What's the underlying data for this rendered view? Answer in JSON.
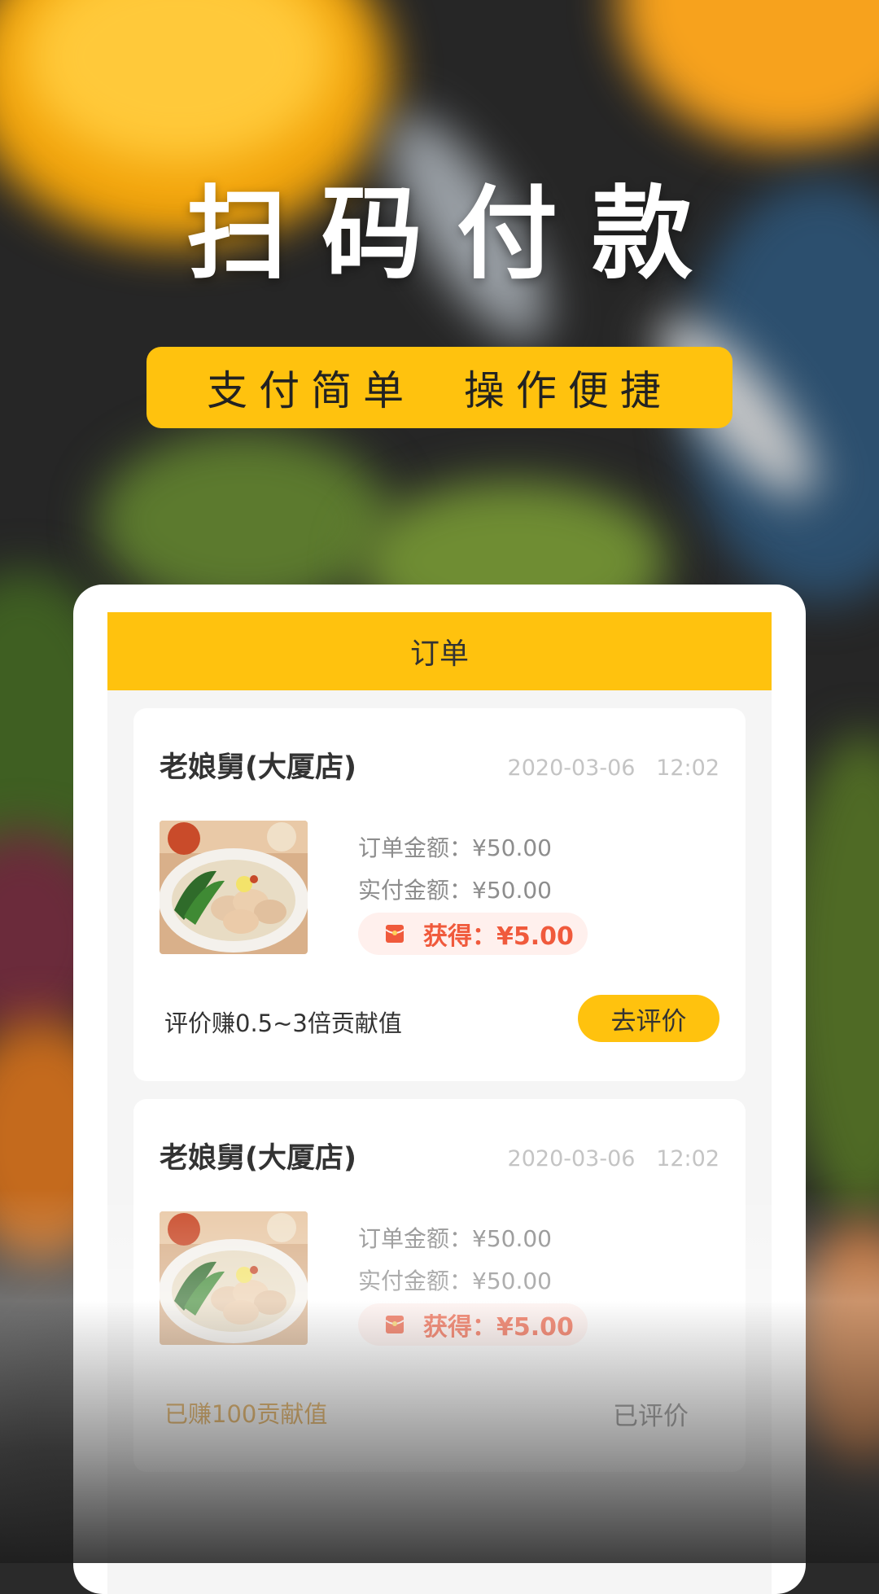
{
  "headline": "扫码付款",
  "tagline": "支付简单  操作便捷",
  "screen": {
    "title": "订单",
    "orders": [
      {
        "shop": "老娘舅(大厦店)",
        "time": "2020-03-06   12:02",
        "order_amount": "订单金额：¥50.00",
        "paid_amount": "实付金额：¥50.00",
        "earned": "获得：¥5.00",
        "hint": "评价赚0.5~3倍贡献值",
        "review_button": "去评价"
      },
      {
        "shop": "老娘舅(大厦店)",
        "time": "2020-03-06   12:02",
        "order_amount": "订单金额：¥50.00",
        "paid_amount": "实付金额：¥50.00",
        "earned": "获得：¥5.00",
        "earned_note": "已赚100贡献值",
        "review_status": "已评价"
      }
    ]
  },
  "colors": {
    "accent": "#ffc20e",
    "earn_text": "#f05a3c",
    "earned_note": "#e0a548"
  },
  "icons": [
    "red-envelope-icon",
    "dumpling-food-photo"
  ]
}
